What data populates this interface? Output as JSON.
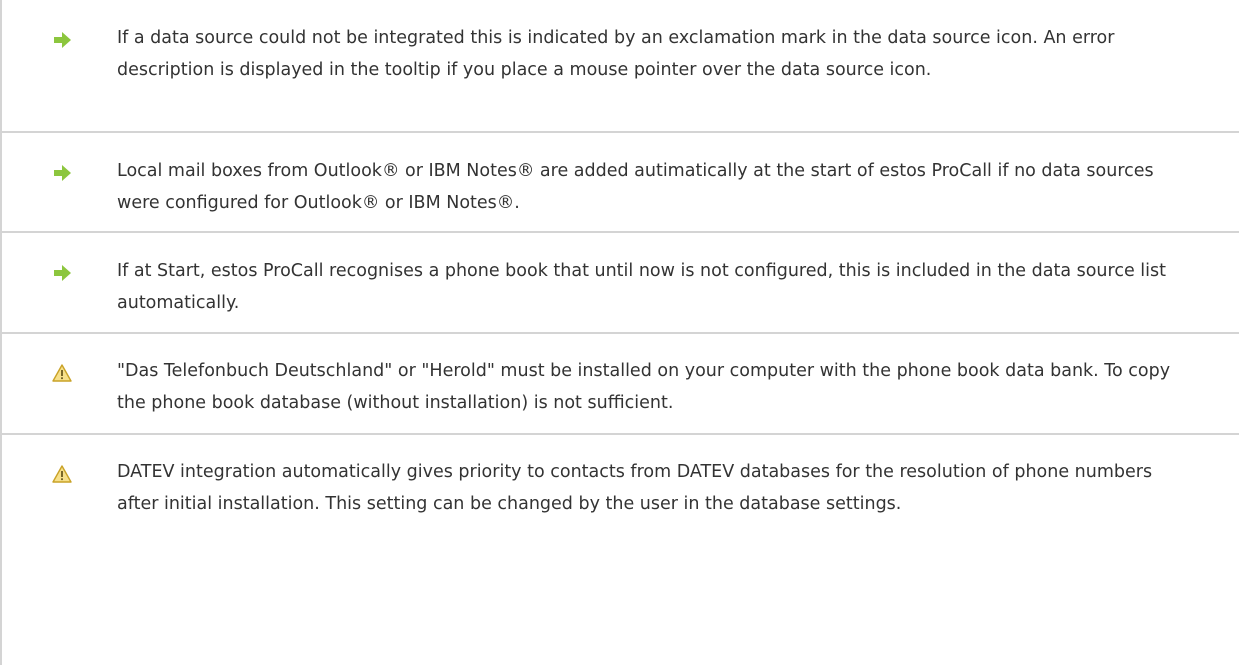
{
  "notes": [
    {
      "type": "tip",
      "icon": "arrow-right-icon",
      "text": "If a data source could not be integrated this is indicated by an exclamation mark in the data source icon. An error description is displayed in the tooltip if you place a mouse pointer over the data source icon."
    },
    {
      "type": "tip",
      "icon": "arrow-right-icon",
      "text": "Local mail boxes from Outlook® or IBM Notes® are added autimatically at the start of estos ProCall if no data sources were configured for Outlook® or IBM Notes®."
    },
    {
      "type": "tip",
      "icon": "arrow-right-icon",
      "text": "If at Start, estos ProCall recognises a phone book that until now is not configured, this is included in the data source list automatically."
    },
    {
      "type": "warning",
      "icon": "warning-icon",
      "text": "\"Das Telefonbuch Deutschland\" or \"Herold\" must be installed on your computer with the phone book data bank. To copy the phone book database (without installation) is not sufficient."
    },
    {
      "type": "warning",
      "icon": "warning-icon",
      "text": "DATEV integration automatically gives priority to contacts from DATEV databases for the resolution of phone numbers after initial installation. This setting can be changed by the user in the database settings."
    }
  ],
  "colors": {
    "tip_arrow": "#8cc63e",
    "warning_fill": "#f7e08a",
    "warning_stroke": "#c9a227",
    "border": "#d4d4d4",
    "text": "#333333"
  }
}
